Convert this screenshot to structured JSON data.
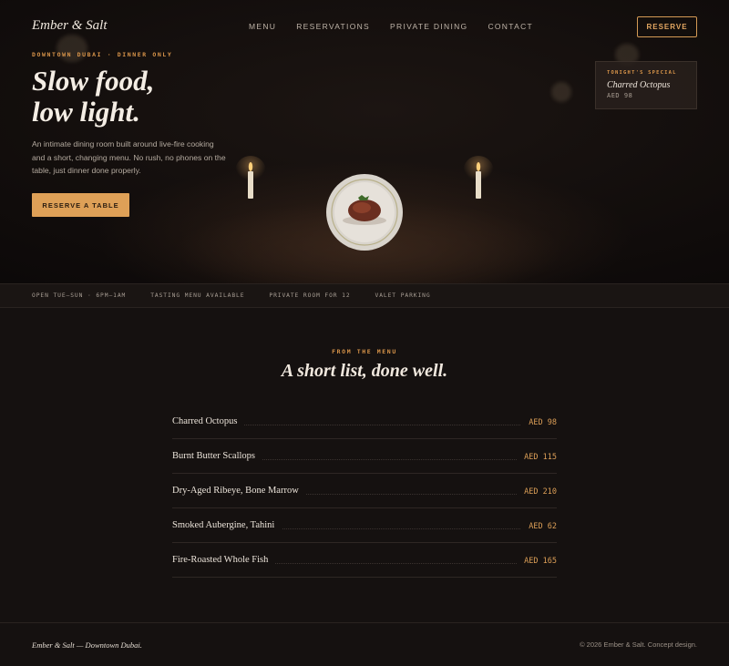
{
  "nav": {
    "logo": "Ember & Salt",
    "links": [
      "MENU",
      "RESERVATIONS",
      "PRIVATE DINING",
      "CONTACT"
    ],
    "reserve_label": "RESERVE"
  },
  "hero": {
    "eyebrow": "DOWNTOWN DUBAI · DINNER ONLY",
    "title_line1": "Slow food,",
    "title_line2": "low light.",
    "description": "An intimate dining room built around live-fire cooking and a short, changing menu. No rush, no phones on the table, just dinner done properly.",
    "cta_label": "RESERVE A TABLE"
  },
  "special": {
    "label": "TONIGHT'S SPECIAL",
    "name": "Charred Octopus",
    "price": "AED 98"
  },
  "strip": [
    "OPEN TUE–SUN · 6PM–1AM",
    "TASTING MENU AVAILABLE",
    "PRIVATE ROOM FOR 12",
    "VALET PARKING"
  ],
  "menu": {
    "eyebrow": "FROM THE MENU",
    "title": "A short list, done well.",
    "items": [
      {
        "name": "Charred Octopus",
        "price": "AED 98"
      },
      {
        "name": "Burnt Butter Scallops",
        "price": "AED 115"
      },
      {
        "name": "Dry-Aged Ribeye, Bone Marrow",
        "price": "AED 210"
      },
      {
        "name": "Smoked Aubergine, Tahini",
        "price": "AED 62"
      },
      {
        "name": "Fire-Roasted Whole Fish",
        "price": "AED 165"
      }
    ]
  },
  "footer": {
    "left": "Ember & Salt — Downtown Dubai.",
    "right": "© 2026 Ember & Salt. Concept design."
  },
  "colors": {
    "accent": "#dea057",
    "background": "#151110"
  }
}
